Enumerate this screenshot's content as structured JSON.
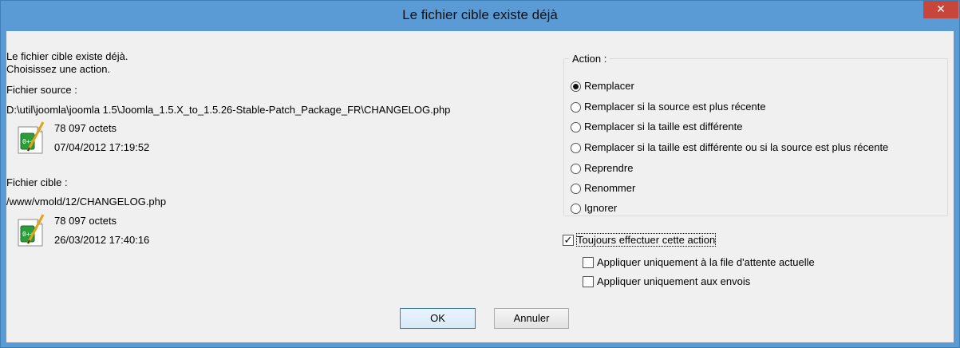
{
  "window": {
    "title": "Le fichier cible existe déjà",
    "close_label": "✕"
  },
  "message": {
    "line1": "Le fichier cible existe déjà.",
    "line2": "Choisissez une action."
  },
  "source": {
    "heading": "Fichier source :",
    "path": "D:\\util\\joomla\\joomla 1.5\\Joomla_1.5.X_to_1.5.26-Stable-Patch_Package_FR\\CHANGELOG.php",
    "size": "78 097 octets",
    "date": "07/04/2012 17:19:52",
    "icon": "php-file-icon"
  },
  "target": {
    "heading": "Fichier cible :",
    "path": "/www/vmold/12/CHANGELOG.php",
    "size": "78 097 octets",
    "date": "26/03/2012 17:40:16",
    "icon": "php-file-icon"
  },
  "action": {
    "legend": "Action :",
    "selected": "Remplacer",
    "options": [
      "Remplacer",
      "Remplacer si la source est plus récente",
      "Remplacer si la taille est différente",
      "Remplacer si la taille est différente ou si la source est plus récente",
      "Reprendre",
      "Renommer",
      "Ignorer"
    ]
  },
  "always": {
    "label": "Toujours effectuer cette action",
    "checked": true,
    "sub_queue": "Appliquer uniquement à la file d'attente actuelle",
    "sub_queue_checked": false,
    "sub_uploads": "Appliquer uniquement aux envois",
    "sub_uploads_checked": false
  },
  "buttons": {
    "ok": "OK",
    "cancel": "Annuler"
  },
  "colors": {
    "titlebar": "#5b9bd5",
    "close": "#c7453a",
    "client": "#f0f0f0"
  }
}
